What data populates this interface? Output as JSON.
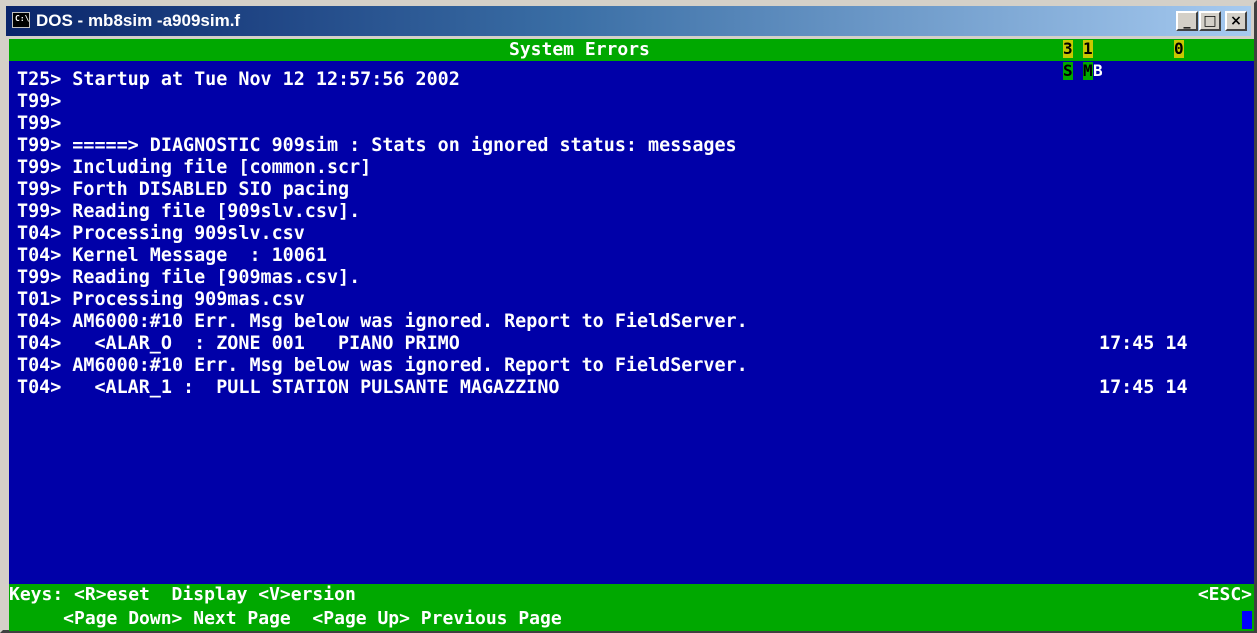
{
  "window": {
    "title": "DOS - mb8sim -a909sim.f",
    "icon_label": "C:\\",
    "buttons": [
      "_",
      "□",
      "×"
    ]
  },
  "header": {
    "title": "System Errors",
    "indicators": {
      "top": [
        "3",
        "1",
        "0"
      ],
      "bottom": [
        "S",
        "M",
        "B"
      ]
    }
  },
  "log": [
    {
      "prefix": "T25>",
      "text": "Startup at Tue Nov 12 12:57:56 2002",
      "time": ""
    },
    {
      "prefix": "T99>",
      "text": "",
      "time": ""
    },
    {
      "prefix": "T99>",
      "text": "",
      "time": ""
    },
    {
      "prefix": "T99>",
      "text": "=====> DIAGNOSTIC 909sim : Stats on ignored status: messages",
      "time": ""
    },
    {
      "prefix": "T99>",
      "text": "Including file [common.scr]",
      "time": ""
    },
    {
      "prefix": "T99>",
      "text": "Forth DISABLED SIO pacing",
      "time": ""
    },
    {
      "prefix": "T99>",
      "text": "Reading file [909slv.csv].",
      "time": ""
    },
    {
      "prefix": "T04>",
      "text": "Processing 909slv.csv",
      "time": ""
    },
    {
      "prefix": "T04>",
      "text": "Kernel Message  : 10061",
      "time": ""
    },
    {
      "prefix": "T99>",
      "text": "Reading file [909mas.csv].",
      "time": ""
    },
    {
      "prefix": "T01>",
      "text": "Processing 909mas.csv",
      "time": ""
    },
    {
      "prefix": "T04>",
      "text": "AM6000:#10 Err. Msg below was ignored. Report to FieldServer.",
      "time": ""
    },
    {
      "prefix": "T04>",
      "text": "  <ALAR_O  : ZONE 001   PIANO PRIMO",
      "time": "17:45 14"
    },
    {
      "prefix": "T04>",
      "text": "AM6000:#10 Err. Msg below was ignored. Report to FieldServer.",
      "time": ""
    },
    {
      "prefix": "T04>",
      "text": "  <ALAR_1 :  PULL STATION PULSANTE MAGAZZINO",
      "time": "17:45 14"
    }
  ],
  "footer": {
    "keys_line1": "Keys: <R>eset  Display <V>ersion",
    "keys_line2": "     <Page Down> Next Page  <Page Up> Previous Page",
    "esc": "<ESC>"
  },
  "colors": {
    "background": "#0000a8",
    "bar": "#00a800",
    "text": "#ffffff"
  }
}
